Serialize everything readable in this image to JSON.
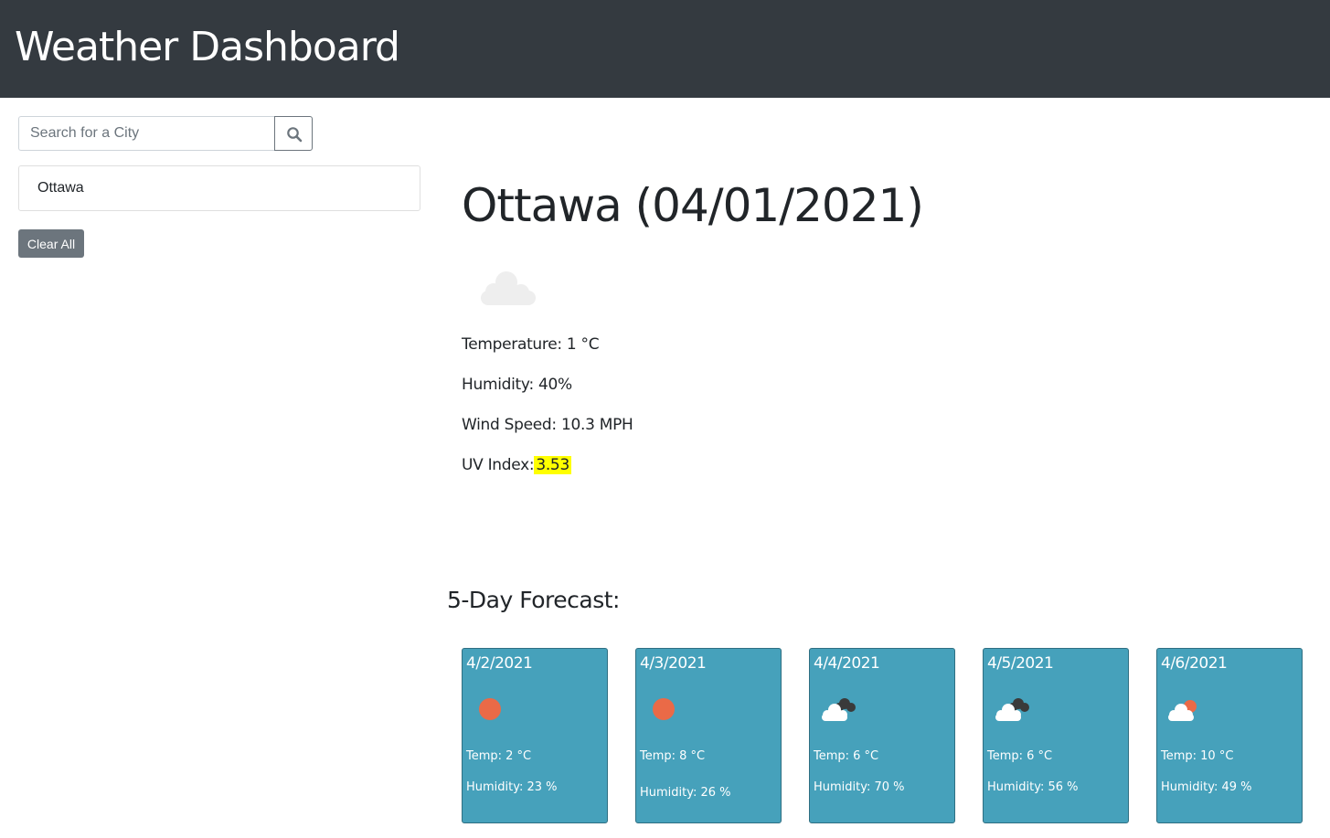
{
  "header": {
    "title": "Weather Dashboard"
  },
  "search": {
    "placeholder": "Search for a City",
    "value": "",
    "button_icon": "search-icon"
  },
  "history": [
    {
      "label": "Ottawa"
    }
  ],
  "clear_label": "Clear All",
  "current": {
    "title": "Ottawa (04/01/2021)",
    "icon": "cloud-icon",
    "temperature_label": "Temperature: 1 °C",
    "humidity_label": "Humidity: 40%",
    "wind_label": "Wind Speed: 10.3 MPH",
    "uv_label": "UV Index:",
    "uv_value": "3.53",
    "uv_color": "#ffff00"
  },
  "forecast": {
    "title": "5-Day Forecast:",
    "card_color": "#46a1bb",
    "days": [
      {
        "date": "4/2/2021",
        "icon": "sun-icon",
        "temp": "Temp: 2 °C",
        "humidity": "Humidity: 23 %"
      },
      {
        "date": "4/3/2021",
        "icon": "sun-icon",
        "temp": "Temp: 8 °C",
        "humidity": "Humidity: 26 %"
      },
      {
        "date": "4/4/2021",
        "icon": "dark-clouds-icon",
        "temp": "Temp: 6 °C",
        "humidity": "Humidity: 70 %"
      },
      {
        "date": "4/5/2021",
        "icon": "dark-clouds-icon",
        "temp": "Temp: 6 °C",
        "humidity": "Humidity: 56 %"
      },
      {
        "date": "4/6/2021",
        "icon": "partly-sunny-icon",
        "temp": "Temp: 10 °C",
        "humidity": "Humidity: 49 %"
      }
    ]
  }
}
